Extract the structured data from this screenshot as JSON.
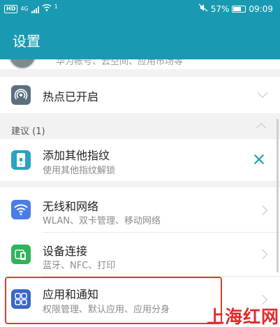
{
  "status_bar": {
    "hd_badge": "HD",
    "signal_label": "4G",
    "wifi_sup": "1",
    "battery": "57%",
    "time": "09:09"
  },
  "header": {
    "title": "设置"
  },
  "account": {
    "subtitle": "华为帐号、云空间、应用市场等"
  },
  "hotspot": {
    "title": "热点已开启"
  },
  "suggestions": {
    "label": "建议 (1)",
    "item": {
      "title": "添加其他指纹",
      "subtitle": "使用其他指纹解锁"
    }
  },
  "settings_items": [
    {
      "title": "无线和网络",
      "subtitle": "WLAN、双卡管理、移动网络"
    },
    {
      "title": "设备连接",
      "subtitle": "蓝牙、NFC、打印"
    },
    {
      "title": "应用和通知",
      "subtitle": "权限管理、默认应用、应用分身"
    }
  ],
  "watermark": "上海红网",
  "colors": {
    "accent": "#1a9ab2",
    "highlight": "#e23a2f",
    "watermark": "#e3292b"
  }
}
